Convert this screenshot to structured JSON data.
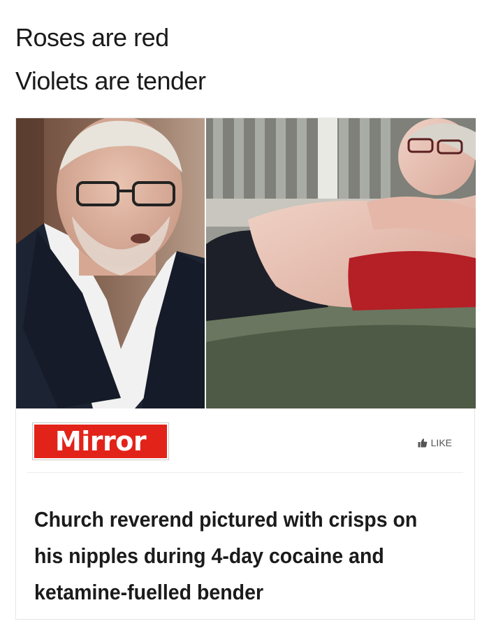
{
  "caption": {
    "line1": "Roses are red",
    "line2": "Violets are tender"
  },
  "article": {
    "brand": "Mirror",
    "like_label": "LIKE",
    "headline": "Church reverend pictured with crisps on his nipples during 4-day cocaine and ketamine-fuelled bender"
  },
  "icons": {
    "like": "thumbs-up-icon"
  },
  "colors": {
    "brand_red": "#e2231a"
  }
}
